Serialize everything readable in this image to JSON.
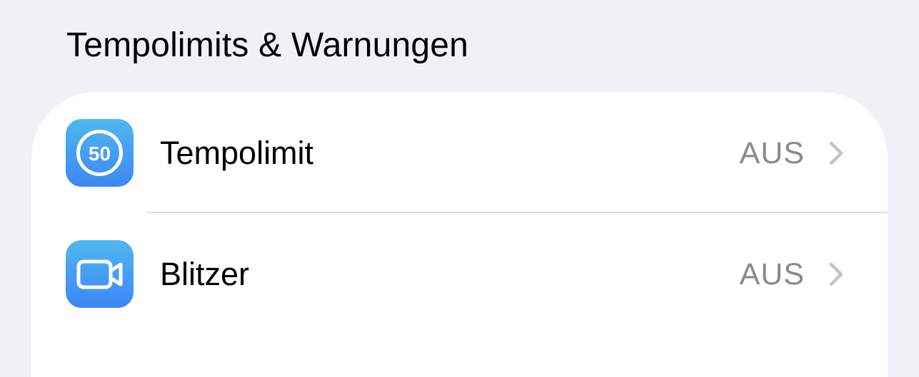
{
  "section": {
    "title": "Tempolimits & Warnungen"
  },
  "rows": [
    {
      "label": "Tempolimit",
      "value": "AUS",
      "icon": "speed-limit-50-icon",
      "icon_text": "50"
    },
    {
      "label": "Blitzer",
      "value": "AUS",
      "icon": "video-camera-icon"
    }
  ],
  "colors": {
    "background": "#F0F0F5",
    "card": "#FFFFFF",
    "icon_gradient_top": "#4FB8EE",
    "icon_gradient_bottom": "#3D86F6",
    "secondary_text": "#8A8A8E",
    "chevron": "#C4C4C7",
    "divider": "#E1E1E4"
  }
}
